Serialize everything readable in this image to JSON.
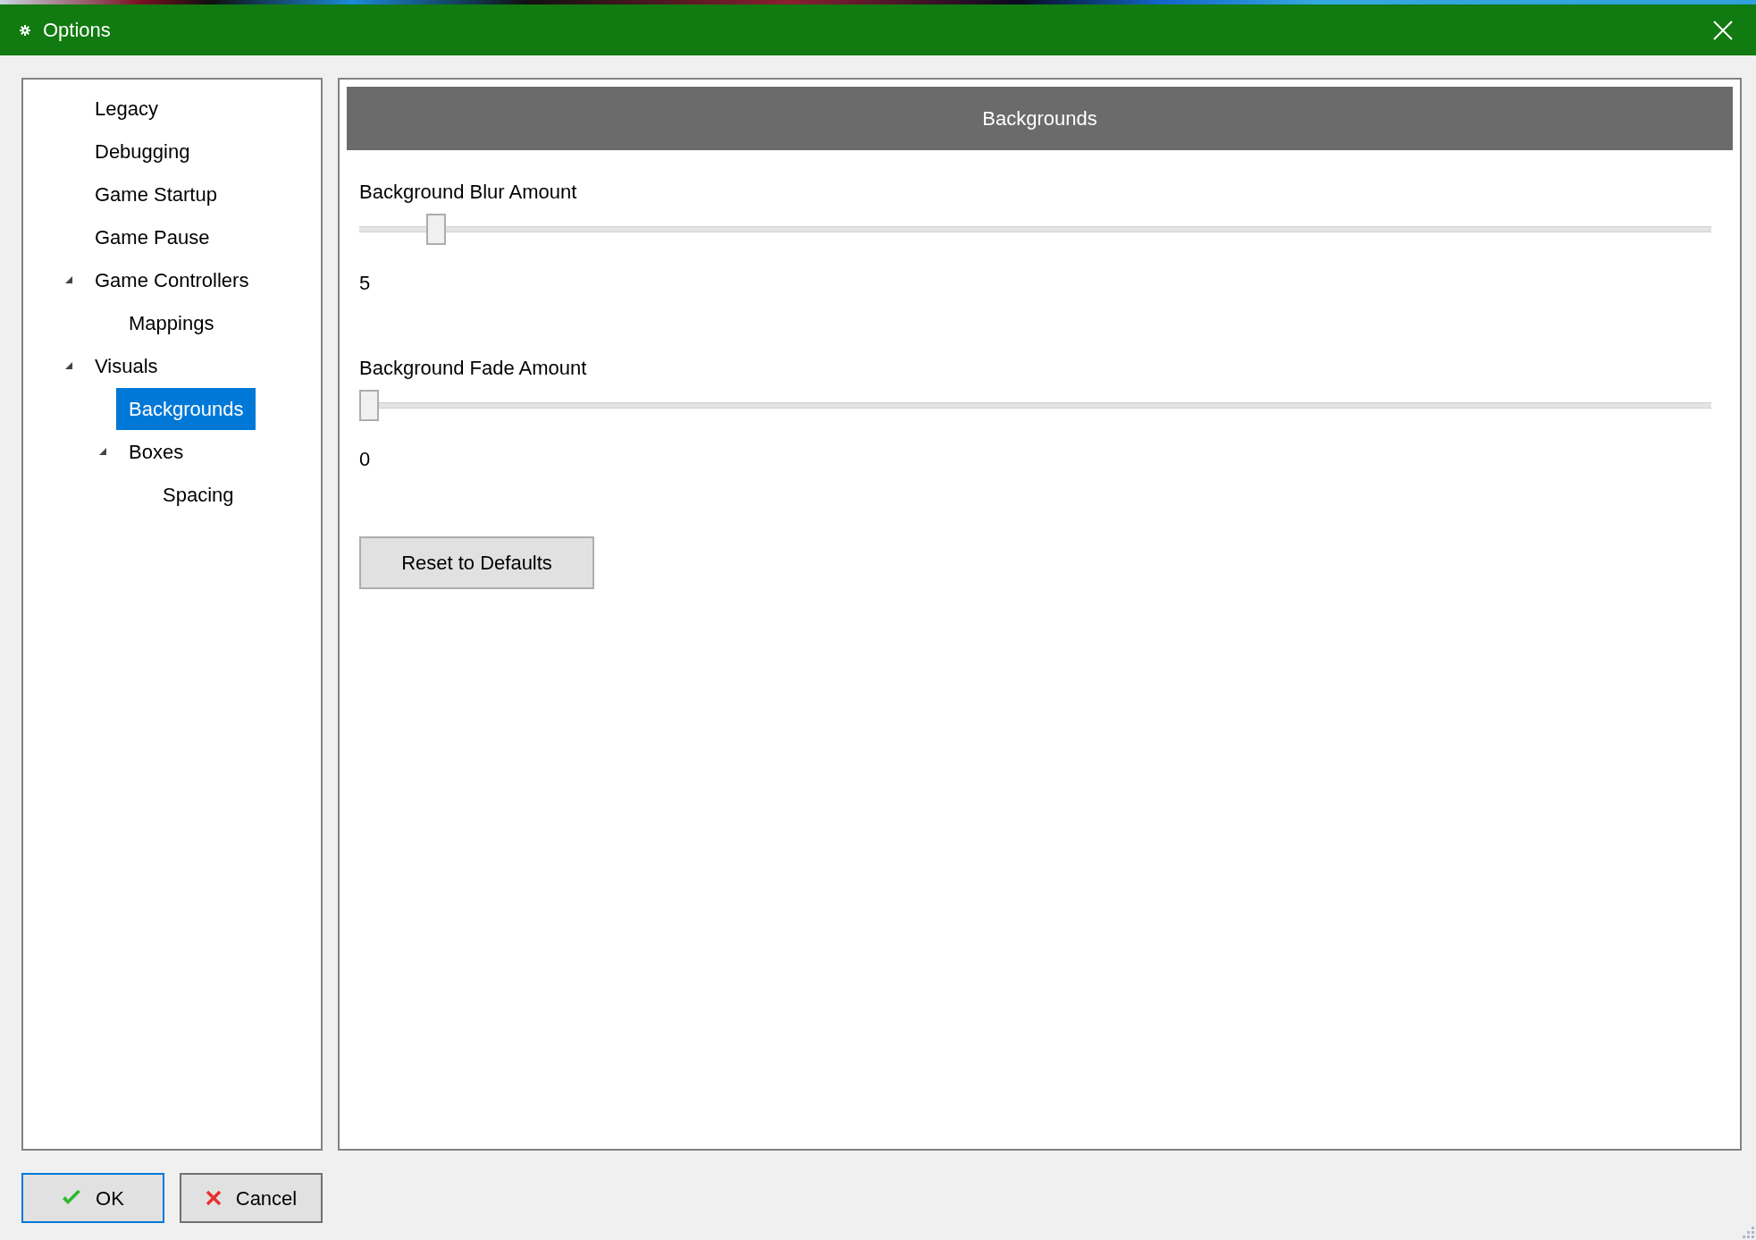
{
  "window": {
    "title": "Options"
  },
  "tree": [
    {
      "label": "Legacy",
      "selected": false
    },
    {
      "label": "Debugging",
      "selected": false
    },
    {
      "label": "Game Startup",
      "selected": false
    },
    {
      "label": "Game Pause",
      "selected": false
    },
    {
      "label": "Game Controllers",
      "selected": false,
      "expanded": true,
      "children": [
        {
          "label": "Mappings",
          "selected": false
        }
      ]
    },
    {
      "label": "Visuals",
      "selected": false,
      "expanded": true,
      "children": [
        {
          "label": "Backgrounds",
          "selected": true
        },
        {
          "label": "Boxes",
          "selected": false,
          "expanded": true,
          "children": [
            {
              "label": "Spacing",
              "selected": false
            }
          ]
        }
      ]
    }
  ],
  "panel": {
    "header": "Backgrounds",
    "sliders": [
      {
        "label": "Background Blur Amount",
        "level": 0.05,
        "reading": "5"
      },
      {
        "label": "Background Fade Amount",
        "level": 0,
        "reading": "0"
      }
    ],
    "reset_button": "Reset to Defaults"
  },
  "buttons": [
    {
      "label": "OK",
      "kind": "confirm",
      "default": true
    },
    {
      "label": "Cancel",
      "kind": "cancel",
      "default": false
    }
  ]
}
